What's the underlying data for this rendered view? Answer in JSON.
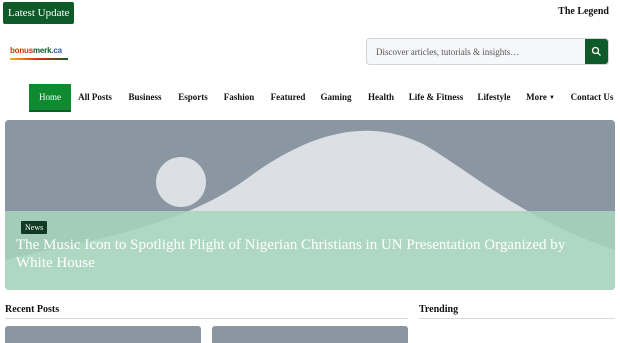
{
  "topbar": {
    "latest_label": "Latest Update",
    "legend_label": "The Legend"
  },
  "logo": {
    "part1": "bonus",
    "part2": "merk",
    "part3": ".ca"
  },
  "search": {
    "placeholder": "Discover articles, tutorials & insights…",
    "icon": "search-icon"
  },
  "nav": {
    "items": [
      {
        "label": "Home",
        "active": true
      },
      {
        "label": "All Posts"
      },
      {
        "label": "Business"
      },
      {
        "label": "Esports"
      },
      {
        "label": "Fashion"
      },
      {
        "label": "Featured"
      },
      {
        "label": "Gaming"
      },
      {
        "label": "Health"
      },
      {
        "label": "Life & Fitness"
      },
      {
        "label": "Lifestyle"
      },
      {
        "label": "More"
      },
      {
        "label": "Contact Us"
      }
    ]
  },
  "hero": {
    "tag": "News",
    "title": "The Music Icon to Spotlight Plight of Nigerian Christians in UN Presentation Organized by White House"
  },
  "sections": {
    "recent": "Recent Posts",
    "trending": "Trending"
  },
  "colors": {
    "brand_green": "#0f5a29",
    "nav_active": "#0f8a2e",
    "placeholder_gray": "#8a96a2"
  }
}
